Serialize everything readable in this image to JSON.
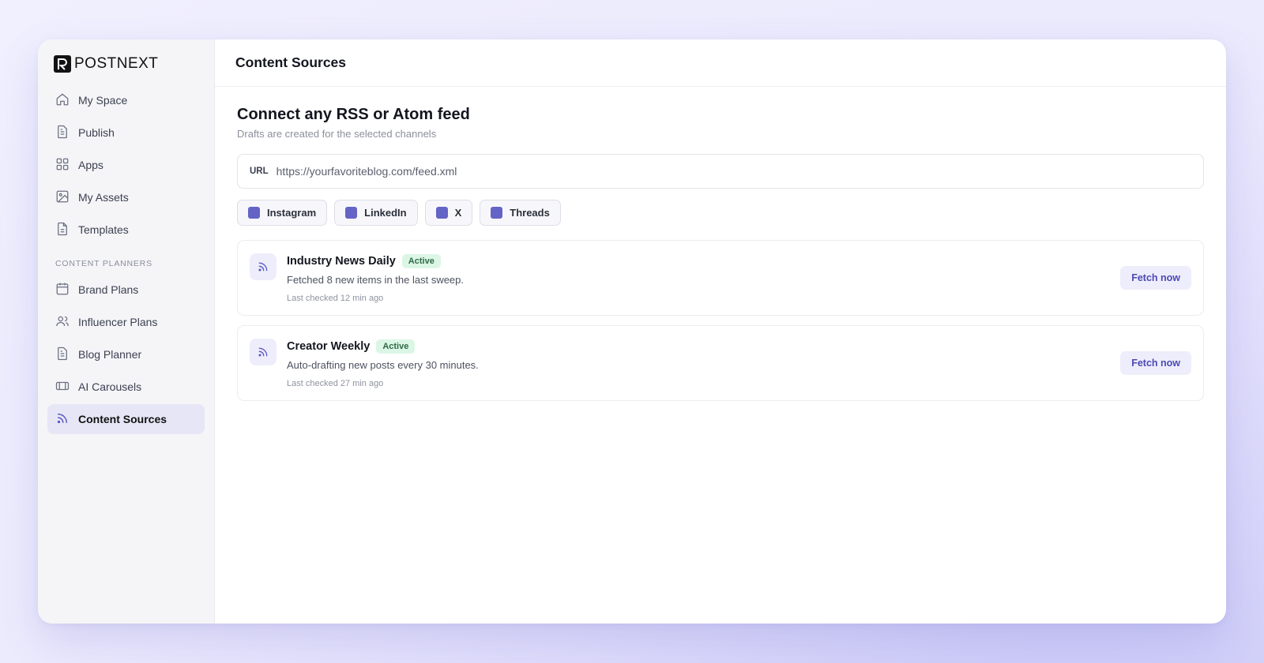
{
  "brand": {
    "name": "POSTNEXT"
  },
  "sidebar": {
    "items": [
      {
        "label": "My Space",
        "icon": "home-icon"
      },
      {
        "label": "Publish",
        "icon": "document-icon"
      },
      {
        "label": "Apps",
        "icon": "grid-icon"
      },
      {
        "label": "My Assets",
        "icon": "image-icon"
      },
      {
        "label": "Templates",
        "icon": "template-icon"
      }
    ],
    "section_label": "CONTENT PLANNERS",
    "planner_items": [
      {
        "label": "Brand Plans",
        "icon": "calendar-icon"
      },
      {
        "label": "Influencer Plans",
        "icon": "users-icon"
      },
      {
        "label": "Blog Planner",
        "icon": "document-icon"
      },
      {
        "label": "AI Carousels",
        "icon": "carousel-icon"
      },
      {
        "label": "Content Sources",
        "icon": "rss-icon",
        "active": true
      }
    ]
  },
  "header": {
    "title": "Content Sources"
  },
  "main": {
    "heading": "Connect any RSS or Atom feed",
    "subheading": "Drafts are created for the selected channels",
    "url_field": {
      "label": "URL",
      "placeholder": "https://yourfavoriteblog.com/feed.xml"
    },
    "channels": [
      "Instagram",
      "LinkedIn",
      "X",
      "Threads"
    ],
    "feeds": [
      {
        "title": "Industry News Daily",
        "status": "Active",
        "description": "Fetched 8 new items in the last sweep.",
        "last_checked": "Last checked 12 min ago",
        "action": "Fetch now"
      },
      {
        "title": "Creator Weekly",
        "status": "Active",
        "description": "Auto-drafting new posts every 30 minutes.",
        "last_checked": "Last checked 27 min ago",
        "action": "Fetch now"
      }
    ]
  },
  "colors": {
    "accent": "#6463c6",
    "active_nav_bg": "#e7e6f6",
    "badge_bg": "#dcf6e6",
    "badge_text": "#2f6a47",
    "button_text": "#4b4ab6"
  }
}
